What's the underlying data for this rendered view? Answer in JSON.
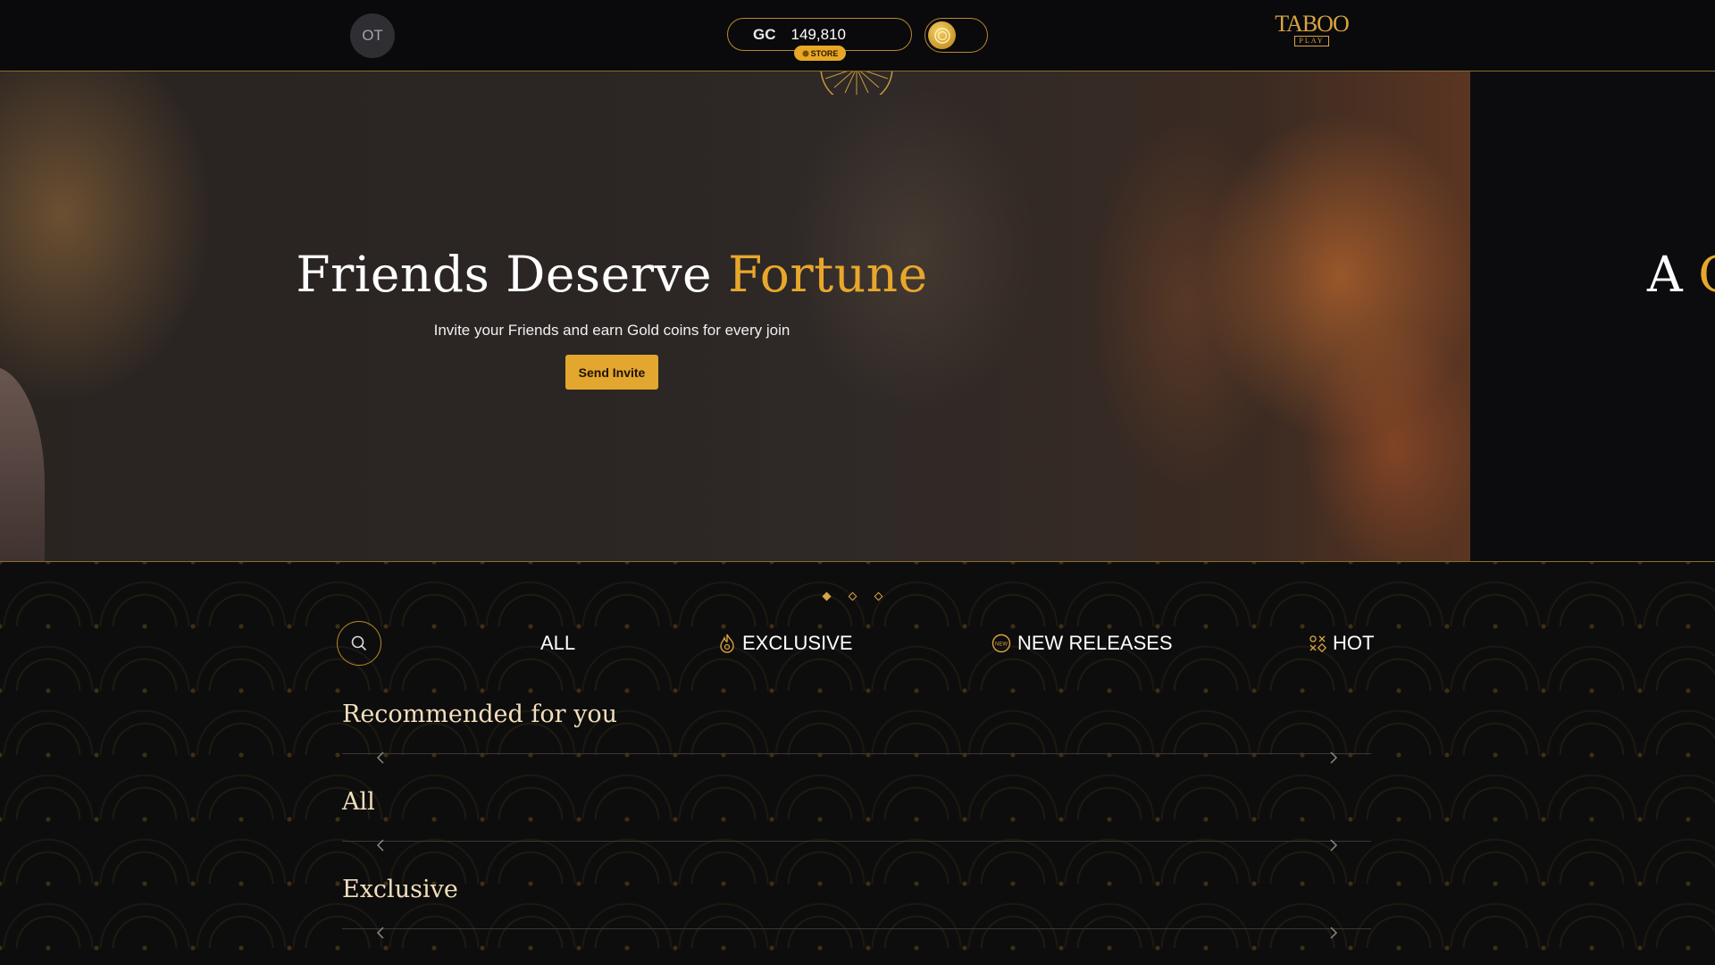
{
  "topbar": {
    "avatar_initials": "OT",
    "balance": {
      "currency": "GC",
      "amount": "149,810",
      "store_label": "STORE"
    },
    "coin_toggle": {
      "icon": "gold-coin-icon"
    },
    "logo": {
      "name": "TABOO",
      "sub": "PLAY"
    }
  },
  "hero": {
    "title_main": "Friends Deserve",
    "title_accent": "Fortune",
    "subtitle": "Invite your Friends and earn Gold coins for every join",
    "button_label": "Send Invite",
    "next_slide_peek_main": "A",
    "next_slide_peek_accent": "C"
  },
  "carousel": {
    "slide_count": 3,
    "active_index": 0
  },
  "tabs": [
    {
      "label": "ALL",
      "icon": ""
    },
    {
      "label": "EXCLUSIVE",
      "icon": "flame-icon"
    },
    {
      "label": "NEW RELEASES",
      "icon": "new-badge-icon"
    },
    {
      "label": "HOT",
      "icon": "grid-icon"
    }
  ],
  "sections": [
    {
      "title": "Recommended for you"
    },
    {
      "title": "All"
    },
    {
      "title": "Exclusive"
    }
  ],
  "colors": {
    "gold": "#e3a62e",
    "gold_border": "#b8892c",
    "cream": "#f1dfbd",
    "background": "#0e0d0d"
  }
}
